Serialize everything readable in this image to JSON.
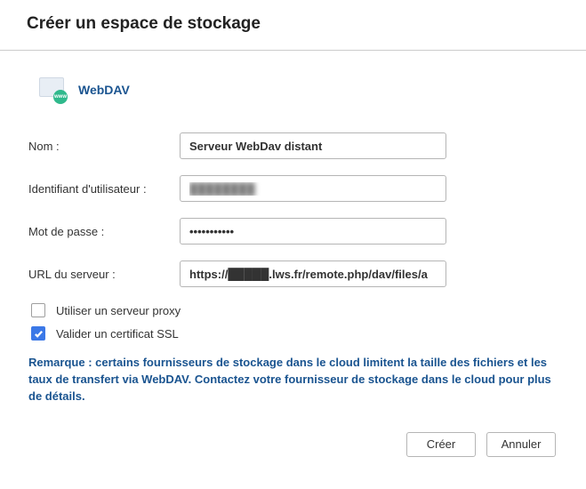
{
  "header": {
    "title": "Créer un espace de stockage"
  },
  "provider": {
    "name": "WebDAV",
    "icon": "webdav-icon"
  },
  "form": {
    "name_label": "Nom :",
    "name_value": "Serveur WebDav distant",
    "user_label": "Identifiant d'utilisateur :",
    "user_value": "████████",
    "password_label": "Mot de passe :",
    "password_value": "•••••••••••",
    "url_label": "URL du serveur :",
    "url_value": "https://█████.lws.fr/remote.php/dav/files/a"
  },
  "checkboxes": {
    "proxy": {
      "label": "Utiliser un serveur proxy",
      "checked": false
    },
    "ssl": {
      "label": "Valider un certificat SSL",
      "checked": true
    }
  },
  "note": "Remarque : certains fournisseurs de stockage dans le cloud limitent la taille des fichiers et les taux de transfert via WebDAV. Contactez votre fournisseur de stockage dans le cloud pour plus de détails.",
  "actions": {
    "create": "Créer",
    "cancel": "Annuler"
  }
}
